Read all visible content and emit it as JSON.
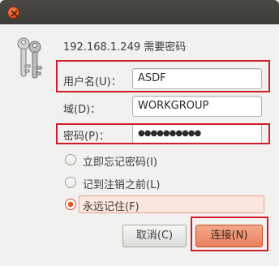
{
  "dialog": {
    "heading": "192.168.1.249 需要密码"
  },
  "form": {
    "username_label": "用户名(U)：",
    "username_value": "ASDF",
    "domain_label": "域(D)：",
    "domain_value": "WORKGROUP",
    "password_label": "密码(P)：",
    "password_value": "●●●●●●●●●●"
  },
  "remember": {
    "options": [
      {
        "label": "立即忘记密码(I)",
        "checked": false
      },
      {
        "label": "记到注销之前(L)",
        "checked": false
      },
      {
        "label": "永远记住(F)",
        "checked": true
      }
    ]
  },
  "buttons": {
    "cancel": "取消(C)",
    "connect": "连接(N)"
  },
  "colors": {
    "highlight_box": "#d11d2a",
    "accent": "#e9815f",
    "titlebar": "#3c3b37"
  },
  "icons": {
    "dialog_icon": "keys-icon",
    "close": "close-icon"
  }
}
